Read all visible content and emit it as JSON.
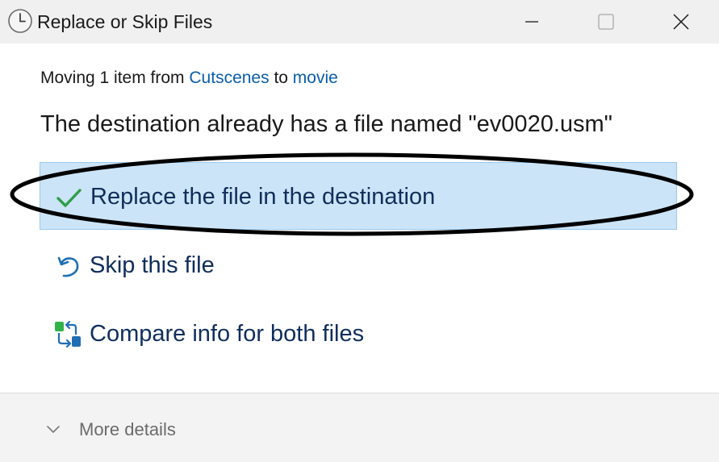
{
  "window": {
    "title": "Replace or Skip Files"
  },
  "header": {
    "moving_prefix": "Moving 1 item from ",
    "source_folder": "Cutscenes",
    "to_word": " to ",
    "dest_folder": "movie",
    "message": "The destination already has a file named \"ev0020.usm\""
  },
  "options": [
    {
      "label": "Replace the file in the destination",
      "icon": "checkmark-icon",
      "selected": true
    },
    {
      "label": "Skip this file",
      "icon": "undo-arrow-icon",
      "selected": false
    },
    {
      "label": "Compare info for both files",
      "icon": "compare-files-icon",
      "selected": false
    }
  ],
  "footer": {
    "more_details_label": "More details"
  },
  "colors": {
    "link": "#0a5ea8",
    "selected_bg": "#cce4f7",
    "option_text": "#0f2e5c",
    "check_green": "#2e9e4a"
  }
}
